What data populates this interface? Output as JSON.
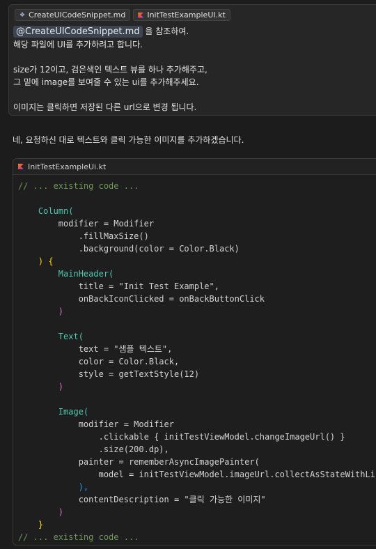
{
  "prompt": {
    "chips": [
      {
        "label": "CreateUICodeSnippet.md",
        "icon": "markdown-icon"
      },
      {
        "label": "InitTestExampleUI.kt",
        "icon": "kotlin-icon"
      }
    ],
    "mention": "@CreateUICodeSnippet.md",
    "line1_rest": " 을 참조하여.",
    "line2": "해당 파일에 UI를 추가하려고 합니다.",
    "line3": "size가 12이고, 검은색인 텍스트 뷰를 하나 추가해주고,",
    "line4": "그 밑에 image를 보여줄 수 있는 ui를 추가해주세요.",
    "line5": "이미지는 클릭하면 저장된 다른 url으로 변경 됩니다."
  },
  "answer": "네, 요청하신 대로 텍스트와 클릭 가능한 이미지를 추가하겠습니다.",
  "code_card": {
    "filename": "InitTestExampleUi.kt",
    "lines": [
      "// ... existing code ...",
      "",
      "    Column(",
      "        modifier = Modifier",
      "            .fillMaxSize()",
      "            .background(color = Color.Black)",
      "    ) {",
      "        MainHeader(",
      "            title = \"Init Test Example\",",
      "            onBackIconClicked = onBackButtonClick",
      "        )",
      "",
      "        Text(",
      "            text = \"샘플 텍스트\",",
      "            color = Color.Black,",
      "            style = getTextStyle(12)",
      "        )",
      "",
      "        Image(",
      "            modifier = Modifier",
      "                .clickable { initTestViewModel.changeImageUrl() }",
      "                .size(200.dp),",
      "            painter = rememberAsyncImagePainter(",
      "                model = initTestViewModel.imageUrl.collectAsStateWithLifecycle().value",
      "            ),",
      "            contentDescription = \"클릭 가능한 이미지\"",
      "        )",
      "    }",
      "// ... existing code ..."
    ]
  }
}
